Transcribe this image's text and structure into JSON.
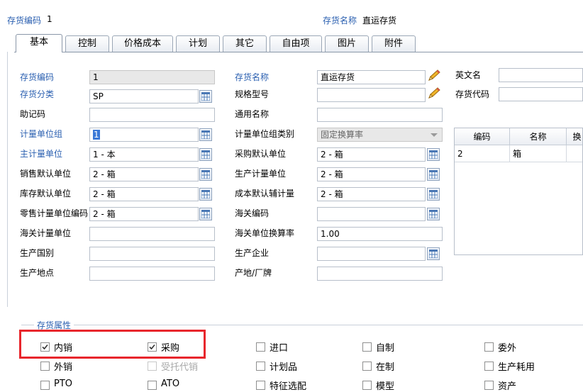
{
  "header": {
    "code_label": "存货编码",
    "code_value": "1",
    "name_label": "存货名称",
    "name_value": "直运存货"
  },
  "tabs": [
    "基本",
    "控制",
    "价格成本",
    "计划",
    "其它",
    "自由项",
    "图片",
    "附件"
  ],
  "form": {
    "col1": {
      "inventory_code_label": "存货编码",
      "inventory_code_value": "1",
      "category_label": "存货分类",
      "category_value": "SP",
      "mnemonic_label": "助记码",
      "mnemonic_value": "",
      "uom_group_label": "计量单位组",
      "uom_group_value": "1",
      "main_uom_label": "主计量单位",
      "main_uom_value": "1 - 本",
      "sales_uom_label": "销售默认单位",
      "sales_uom_value": "2 - 箱",
      "stock_uom_label": "库存默认单位",
      "stock_uom_value": "2 - 箱",
      "retail_uom_label": "零售计量单位编码",
      "retail_uom_value": "2 - 箱",
      "customs_uom_label": "海关计量单位",
      "customs_uom_value": "",
      "origin_country_label": "生产国别",
      "origin_country_value": "",
      "origin_place_label": "生产地点",
      "origin_place_value": ""
    },
    "col2": {
      "inventory_name_label": "存货名称",
      "inventory_name_value": "直运存货",
      "spec_label": "规格型号",
      "spec_value": "",
      "common_name_label": "通用名称",
      "common_name_value": "",
      "uom_group_type_label": "计量单位组类别",
      "uom_group_type_value": "固定换算率",
      "purchase_uom_label": "采购默认单位",
      "purchase_uom_value": "2 - 箱",
      "production_uom_label": "生产计量单位",
      "production_uom_value": "2 - 箱",
      "cost_uom_label": "成本默认辅计量",
      "cost_uom_value": "2 - 箱",
      "customs_code_label": "海关编码",
      "customs_code_value": "",
      "customs_rate_label": "海关单位换算率",
      "customs_rate_value": "1.00",
      "manufacturer_label": "生产企业",
      "manufacturer_value": "",
      "origin_label": "产地/厂牌",
      "origin_value": ""
    },
    "col3": {
      "english_name_label": "英文名",
      "english_name_value": "",
      "inventory_id_label": "存货代码",
      "inventory_id_value": ""
    }
  },
  "unit_table": {
    "headers": [
      "编码",
      "名称",
      "换"
    ],
    "rows": [
      [
        "2",
        "箱",
        ""
      ]
    ]
  },
  "attributes": {
    "title": "存货属性",
    "items": [
      {
        "label": "内销",
        "checked": true,
        "disabled": false
      },
      {
        "label": "采购",
        "checked": true,
        "disabled": false
      },
      {
        "label": "进口",
        "checked": false,
        "disabled": false
      },
      {
        "label": "自制",
        "checked": false,
        "disabled": false
      },
      {
        "label": "委外",
        "checked": false,
        "disabled": false
      },
      {
        "label": "外销",
        "checked": false,
        "disabled": false
      },
      {
        "label": "受托代销",
        "checked": false,
        "disabled": true
      },
      {
        "label": "计划品",
        "checked": false,
        "disabled": false
      },
      {
        "label": "在制",
        "checked": false,
        "disabled": false
      },
      {
        "label": "生产耗用",
        "checked": false,
        "disabled": false
      },
      {
        "label": "PTO",
        "checked": false,
        "disabled": false
      },
      {
        "label": "ATO",
        "checked": false,
        "disabled": false
      },
      {
        "label": "特征选配",
        "checked": false,
        "disabled": false
      },
      {
        "label": "模型",
        "checked": false,
        "disabled": false
      },
      {
        "label": "资产",
        "checked": false,
        "disabled": false
      }
    ]
  },
  "colors": {
    "label_blue": "#2a5fb0",
    "highlight_red": "#e8262c",
    "selection_blue": "#3a78d6"
  }
}
